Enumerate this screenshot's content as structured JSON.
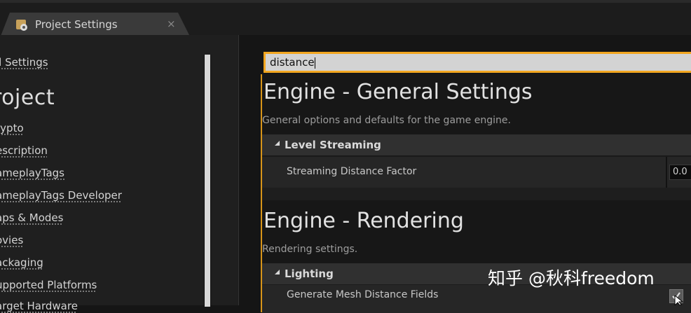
{
  "window": {
    "tab_title": "Project Settings",
    "tab_close": "×",
    "tab_icon": "settings-gear-icon"
  },
  "sidebar": {
    "all_settings": "ll Settings",
    "section_title": "roject",
    "items": [
      {
        "label": "rypto"
      },
      {
        "label": "escription"
      },
      {
        "label": "ameplayTags"
      },
      {
        "label": "ameplayTags Developer"
      },
      {
        "label": "aps & Modes"
      },
      {
        "label": "ovies"
      },
      {
        "label": "ackaging"
      },
      {
        "label": "upported Platforms"
      },
      {
        "label": "arget Hardware"
      }
    ]
  },
  "search": {
    "value": "distance"
  },
  "results": [
    {
      "title": "Engine - General Settings",
      "description": "General options and defaults for the game engine.",
      "group": "Level Streaming",
      "property": "Streaming Distance Factor",
      "value": "0.0"
    },
    {
      "title": "Engine - Rendering",
      "description": "Rendering settings.",
      "group": "Lighting",
      "property": "Generate Mesh Distance Fields",
      "checked": true
    }
  ],
  "watermark": "知乎 @秋科freedom",
  "colors": {
    "accent": "#f2a620",
    "panel": "#1f1f1f",
    "background": "#151515"
  }
}
